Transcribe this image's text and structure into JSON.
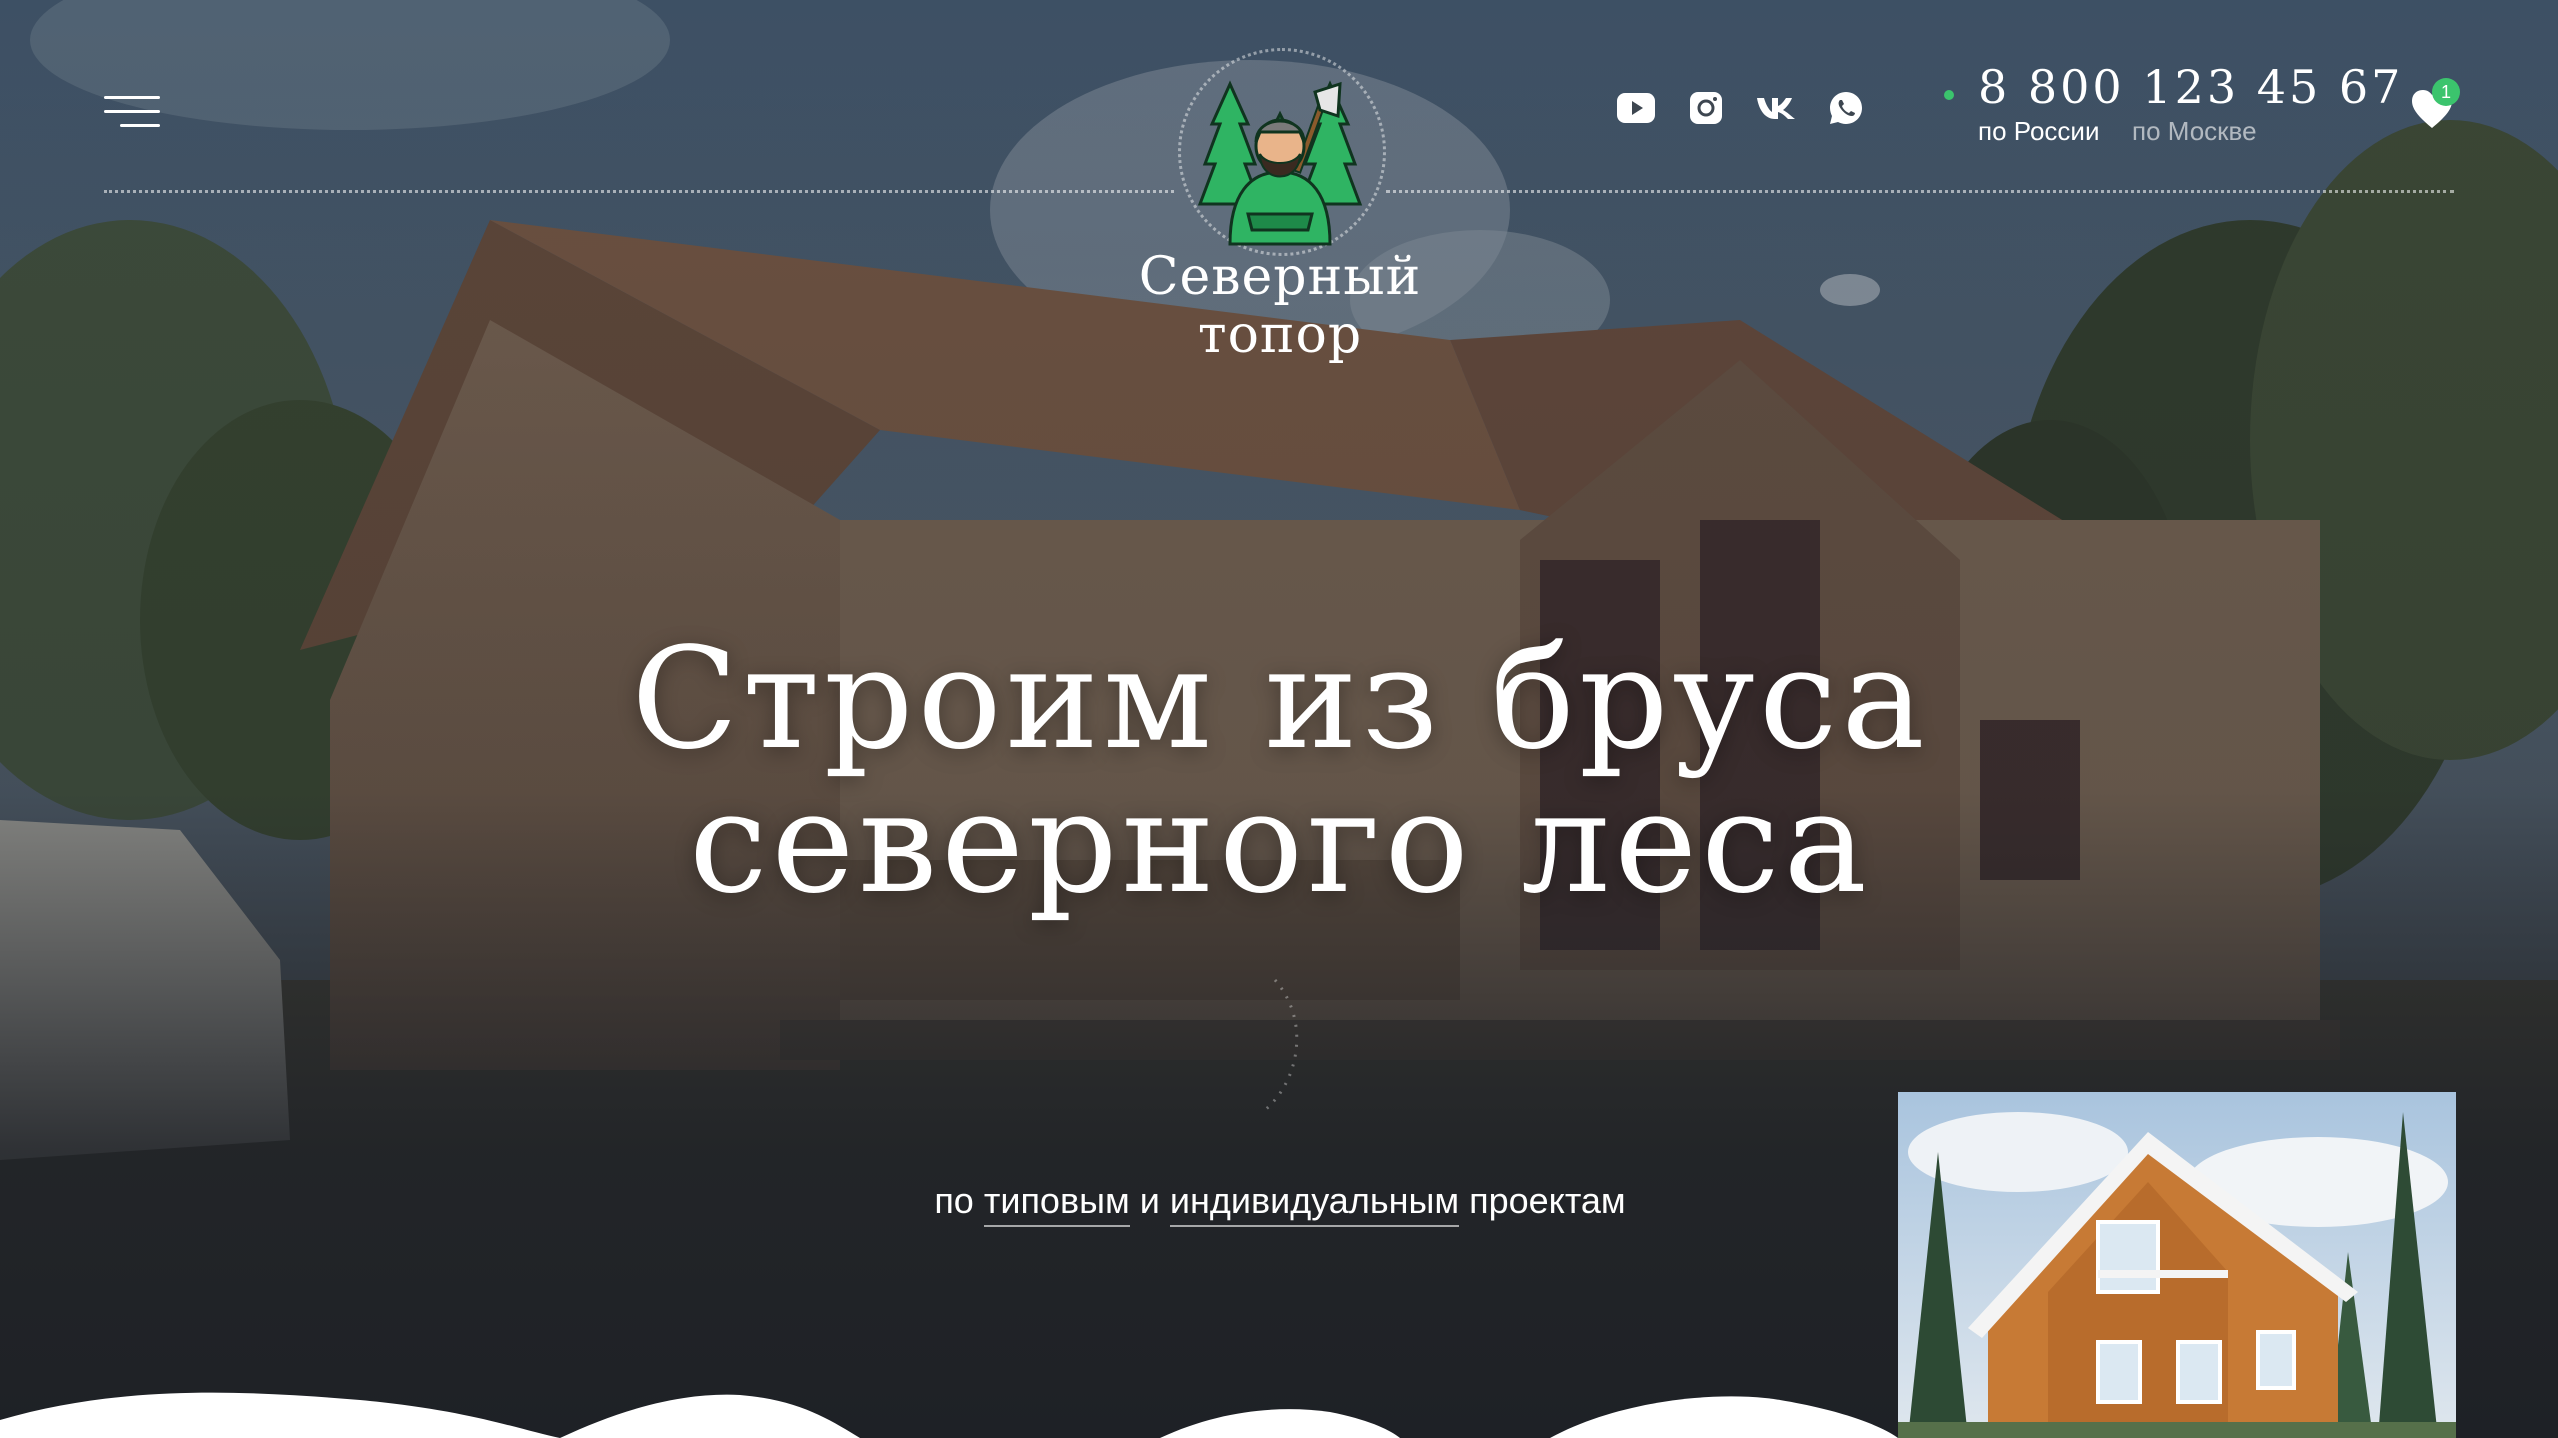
{
  "brand": {
    "name_line1": "Северный",
    "name_line2": "топор"
  },
  "header": {
    "menu_icon": "hamburger-icon",
    "socials": [
      {
        "name": "youtube",
        "icon": "youtube-icon"
      },
      {
        "name": "instagram",
        "icon": "instagram-icon"
      },
      {
        "name": "vk",
        "icon": "vk-icon"
      },
      {
        "name": "whatsapp",
        "icon": "whatsapp-icon"
      }
    ],
    "phone": "8 800 123 45 67",
    "phone_regions": [
      "по России",
      "по Москве"
    ],
    "favorites_count": "1"
  },
  "hero": {
    "title_line1": "Строим из бруса",
    "title_line2": "северного леса",
    "subtitle_prefix": "по",
    "subtitle_link1": "типовым",
    "subtitle_and": "и",
    "subtitle_link2": "индивидуальным",
    "subtitle_suffix": "проектам"
  },
  "colors": {
    "accent_green": "#3bc46d",
    "dark_bg": "#1e2126",
    "white": "#ffffff"
  }
}
